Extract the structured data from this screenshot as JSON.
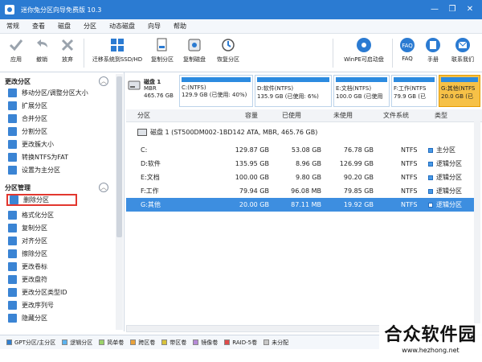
{
  "window": {
    "title": "迷你兔分区向导免费版 10.3",
    "min": "—",
    "max": "❐",
    "close": "✕"
  },
  "menu": [
    "常规",
    "查看",
    "磁盘",
    "分区",
    "动态磁盘",
    "向导",
    "帮助"
  ],
  "toolbar": {
    "apply": "应用",
    "undo": "撤销",
    "discard": "放弃",
    "migrate": "迁移系统到SSD/HD",
    "copy_partition": "复制分区",
    "copy_disk": "复制磁盘",
    "recover_partition": "恢复分区",
    "winpe": "WinPE可启动盘",
    "faq": "FAQ",
    "manual": "手册",
    "contact": "联系我们"
  },
  "sidebar": {
    "section1_title": "更改分区",
    "section1_items": [
      "移动分区/调整分区大小",
      "扩展分区",
      "合并分区",
      "分割分区",
      "更改簇大小",
      "转换NTFS为FAT",
      "设置为主分区"
    ],
    "section2_title": "分区管理",
    "section2_items": [
      "删除分区",
      "格式化分区",
      "复制分区",
      "对齐分区",
      "擦除分区",
      "更改卷标",
      "更改盘符",
      "更改分区类型ID",
      "更改序列号",
      "隐藏分区"
    ]
  },
  "disk": {
    "name": "磁盘 1",
    "style": "MBR",
    "size": "465.76 GB"
  },
  "partition_cards": [
    {
      "line1": "C:(NTFS)",
      "line2": "129.9 GB (已使用: 40%)"
    },
    {
      "line1": "D:软件(NTFS)",
      "line2": "135.9 GB (已使用: 6%)"
    },
    {
      "line1": "E:文档(NTFS)",
      "line2": "100.0 GB (已使用"
    },
    {
      "line1": "F:工作(NTFS",
      "line2": "79.9 GB (已"
    },
    {
      "line1": "G:其他(NTFS",
      "line2": "20.0 GB (已"
    }
  ],
  "table": {
    "headers": [
      "分区",
      "容量",
      "已使用",
      "未使用",
      "文件系统",
      "类型"
    ],
    "disk_row": "磁盘 1 (ST500DM002-1BD142 ATA, MBR, 465.76 GB)",
    "rows": [
      {
        "name": "C:",
        "capacity": "129.87 GB",
        "used": "53.08 GB",
        "unused": "76.78 GB",
        "fs": "NTFS",
        "type": "主分区"
      },
      {
        "name": "D:软件",
        "capacity": "135.95 GB",
        "used": "8.96 GB",
        "unused": "126.99 GB",
        "fs": "NTFS",
        "type": "逻辑分区"
      },
      {
        "name": "E:文档",
        "capacity": "100.00 GB",
        "used": "9.80 GB",
        "unused": "90.20 GB",
        "fs": "NTFS",
        "type": "逻辑分区"
      },
      {
        "name": "F:工作",
        "capacity": "79.94 GB",
        "used": "96.08 MB",
        "unused": "79.85 GB",
        "fs": "NTFS",
        "type": "逻辑分区"
      },
      {
        "name": "G:其他",
        "capacity": "20.00 GB",
        "used": "87.11 MB",
        "unused": "19.92 GB",
        "fs": "NTFS",
        "type": "逻辑分区"
      }
    ]
  },
  "legend": [
    {
      "label": "GPT分区/主分区",
      "color": "#2f7fd1"
    },
    {
      "label": "逻辑分区",
      "color": "#5cb3ef"
    },
    {
      "label": "简单卷",
      "color": "#9bd26a"
    },
    {
      "label": "跨区卷",
      "color": "#e9a23b"
    },
    {
      "label": "带区卷",
      "color": "#d8c23b"
    },
    {
      "label": "镜像卷",
      "color": "#b58ad8"
    },
    {
      "label": "RAID-5卷",
      "color": "#e04b4b"
    },
    {
      "label": "未分配",
      "color": "#c8c8c8"
    }
  ],
  "watermark": {
    "brand": "合众软件园",
    "url": "www.hezhong.net"
  },
  "colors": {
    "title_bar": "#2b7bd2",
    "selected_row": "#3d8ee0",
    "selected_card": "#f6c147",
    "highlight_box": "#e2372f"
  }
}
